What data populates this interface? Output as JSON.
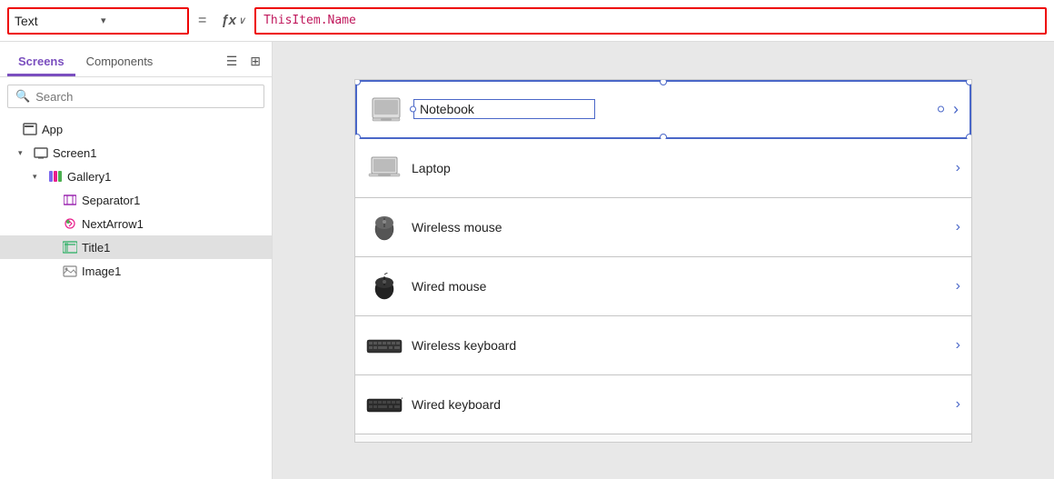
{
  "topbar": {
    "property_label": "Text",
    "dropdown_chevron": "▾",
    "equals": "=",
    "fx_label": "ƒx",
    "fx_chevron": "∨",
    "formula_value": "ThisItem.Name"
  },
  "sidebar": {
    "tab_screens": "Screens",
    "tab_components": "Components",
    "search_placeholder": "Search",
    "tree": [
      {
        "id": "app",
        "level": 0,
        "label": "App",
        "icon": "app-icon",
        "arrow": ""
      },
      {
        "id": "screen1",
        "level": 1,
        "label": "Screen1",
        "icon": "screen-icon",
        "arrow": "▾"
      },
      {
        "id": "gallery1",
        "level": 2,
        "label": "Gallery1",
        "icon": "gallery-icon",
        "arrow": "▾"
      },
      {
        "id": "separator1",
        "level": 3,
        "label": "Separator1",
        "icon": "separator-icon",
        "arrow": ""
      },
      {
        "id": "nextarrow1",
        "level": 3,
        "label": "NextArrow1",
        "icon": "nextarrow-icon",
        "arrow": ""
      },
      {
        "id": "title1",
        "level": 3,
        "label": "Title1",
        "icon": "title-icon",
        "arrow": "",
        "selected": true
      },
      {
        "id": "image1",
        "level": 3,
        "label": "Image1",
        "icon": "image-icon",
        "arrow": ""
      }
    ]
  },
  "canvas": {
    "gallery_items": [
      {
        "id": "notebook",
        "label": "Notebook",
        "icon": "notebook",
        "selected": true
      },
      {
        "id": "laptop",
        "label": "Laptop",
        "icon": "laptop"
      },
      {
        "id": "wireless-mouse",
        "label": "Wireless mouse",
        "icon": "wireless-mouse"
      },
      {
        "id": "wired-mouse",
        "label": "Wired mouse",
        "icon": "wired-mouse"
      },
      {
        "id": "wireless-keyboard",
        "label": "Wireless keyboard",
        "icon": "wireless-keyboard"
      },
      {
        "id": "wired-keyboard",
        "label": "Wired keyboard",
        "icon": "wired-keyboard"
      }
    ]
  },
  "colors": {
    "accent": "#7B4FBF",
    "formula_red": "#c0185c",
    "border_red": "#e00000",
    "selection_blue": "#4a67c8"
  }
}
